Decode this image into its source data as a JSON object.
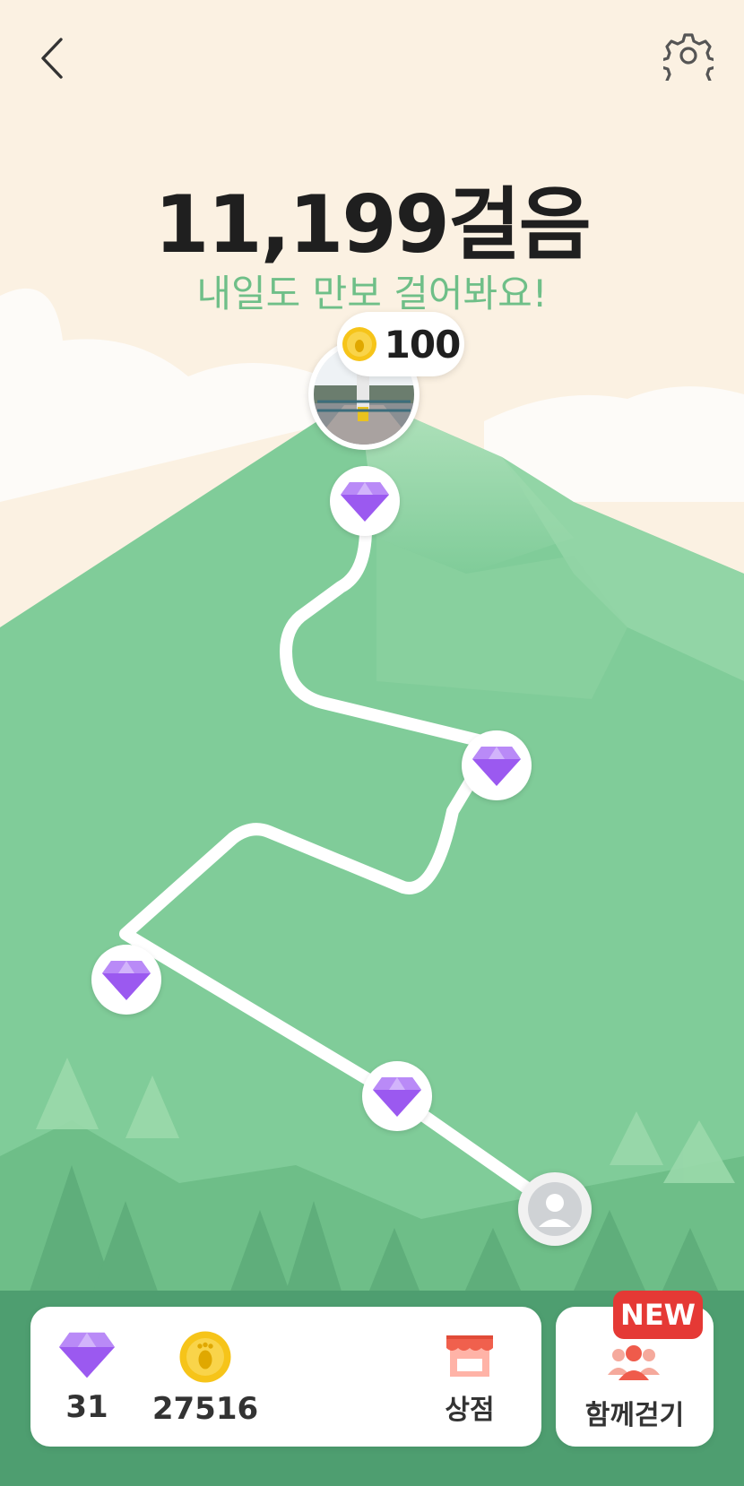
{
  "header": {
    "steps_text": "11,199걸음",
    "subtitle": "내일도 만보 걸어봐요!"
  },
  "summit": {
    "reward_amount": "100"
  },
  "bottom_bar": {
    "gem_count": "31",
    "coin_count": "27516",
    "shop_label": "상점",
    "walk_together_label": "함께걷기",
    "new_badge": "NEW"
  },
  "icons": {
    "back": "chevron-left-icon",
    "settings": "gear-icon",
    "gem": "diamond-icon",
    "coin": "footprint-coin-icon",
    "shop": "storefront-icon",
    "people": "people-icon",
    "avatar": "user-avatar-icon"
  },
  "colors": {
    "sky": "#fbf1e2",
    "mountain": "#80cc99",
    "accent_green": "#6fbf88",
    "gem_purple": "#9b59f0",
    "coin_yellow": "#f6c419",
    "new_red": "#e53935"
  }
}
